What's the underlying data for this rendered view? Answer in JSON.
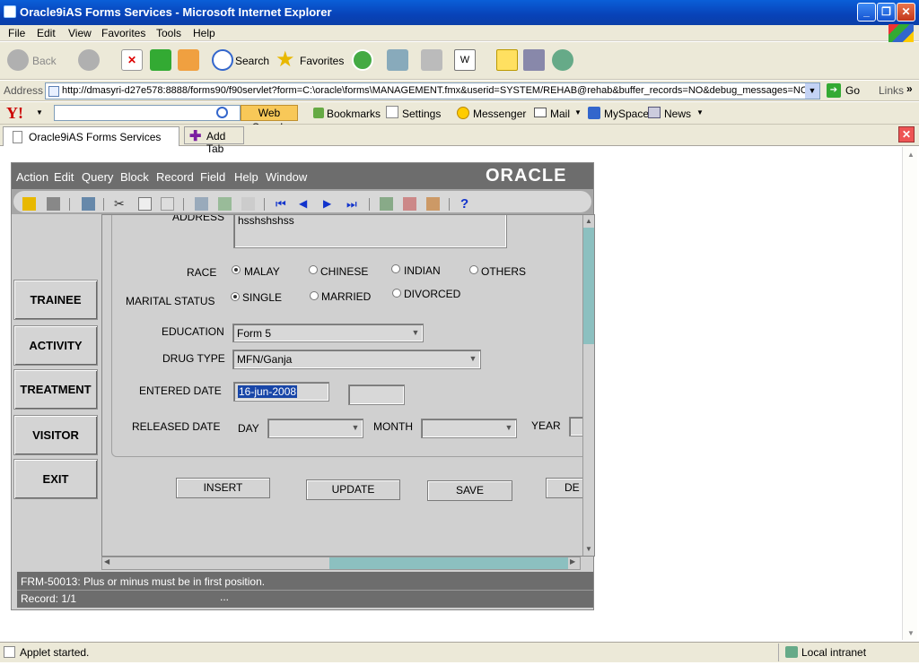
{
  "window": {
    "title": "Oracle9iAS Forms Services - Microsoft Internet Explorer"
  },
  "menu": [
    "File",
    "Edit",
    "View",
    "Favorites",
    "Tools",
    "Help"
  ],
  "toolbar": {
    "back": "Back",
    "search": "Search",
    "favorites": "Favorites"
  },
  "address": {
    "label": "Address",
    "url": "http://dmasyri-d27e578:8888/forms90/f90servlet?form=C:\\oracle\\forms\\MANAGEMENT.fmx&userid=SYSTEM/REHAB@rehab&buffer_records=NO&debug_messages=NO&",
    "go": "Go",
    "links": "Links"
  },
  "yahoo": {
    "web_search": "Web Search",
    "bookmarks": "Bookmarks",
    "settings": "Settings",
    "messenger": "Messenger",
    "mail": "Mail",
    "myspace": "MySpace",
    "news": "News"
  },
  "tabs": {
    "active": "Oracle9iAS Forms Services",
    "add": "Add Tab"
  },
  "status": {
    "text": "Applet started.",
    "zone": "Local intranet"
  },
  "applet": {
    "menu": [
      "Action",
      "Edit",
      "Query",
      "Block",
      "Record",
      "Field",
      "Help",
      "Window"
    ],
    "logo": "ORACLE",
    "side_buttons": [
      "TRAINEE",
      "ACTIVITY",
      "TREATMENT",
      "VISITOR",
      "EXIT"
    ],
    "form": {
      "address_label": "ADDRESS",
      "address_value": "hsshshshss",
      "race_label": "RACE",
      "race_options": [
        "MALAY",
        "CHINESE",
        "INDIAN",
        "OTHERS"
      ],
      "race_selected": "MALAY",
      "marital_label": "MARITAL STATUS",
      "marital_options": [
        "SINGLE",
        "MARRIED",
        "DIVORCED"
      ],
      "marital_selected": "SINGLE",
      "education_label": "EDUCATION",
      "education_value": "Form 5",
      "drug_label": "DRUG TYPE",
      "drug_value": "MFN/Ganja",
      "entered_label": "ENTERED DATE",
      "entered_value": "16-jun-2008",
      "released_label": "RELEASED DATE",
      "day_label": "DAY",
      "month_label": "MONTH",
      "year_label": "YEAR",
      "buttons": [
        "INSERT",
        "UPDATE",
        "SAVE",
        "DE"
      ]
    },
    "message": "FRM-50013: Plus or minus must be in first position.",
    "record": "Record: 1/1",
    "record_dots": "..."
  }
}
